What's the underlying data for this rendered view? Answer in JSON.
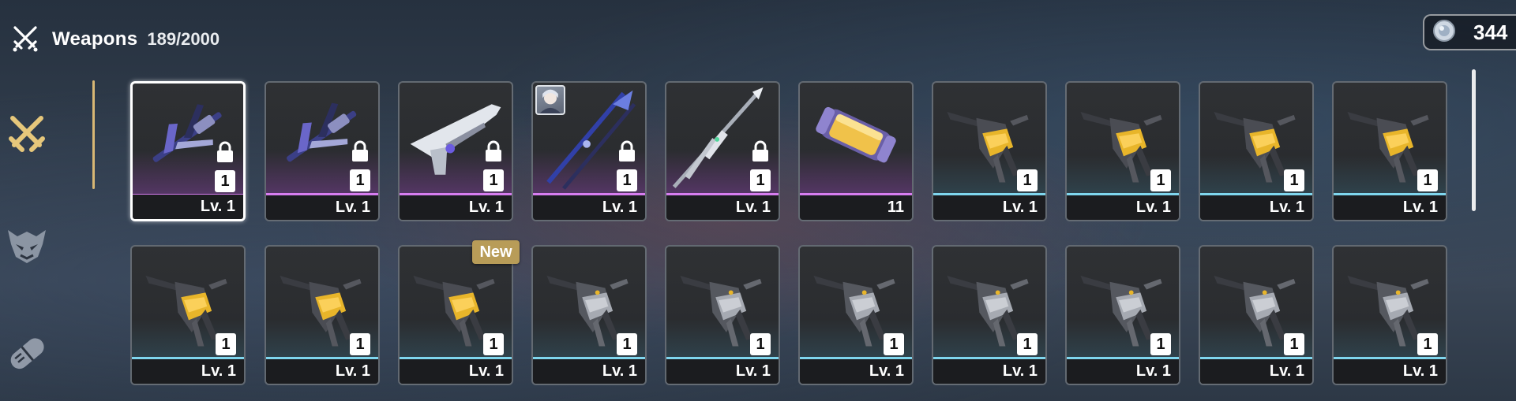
{
  "header": {
    "title": "Weapons",
    "count": "189/2000",
    "icon": "crossed-swords-icon"
  },
  "currency": {
    "icon": "coin-icon",
    "value": "344"
  },
  "nav": {
    "items": [
      {
        "name": "weapons",
        "icon": "crossed-swords-icon",
        "active": true
      },
      {
        "name": "matrices",
        "icon": "demon-mask-icon",
        "active": false
      },
      {
        "name": "relics",
        "icon": "capsule-icon",
        "active": false
      }
    ]
  },
  "colors": {
    "accent": "#d8b774",
    "rarity_purple": "#d77df0",
    "rarity_blue": "#7fd6ee",
    "new_badge": "#b89c58"
  },
  "new_badge": "New",
  "items": [
    {
      "art": "violet-polearm",
      "rarity": "purple",
      "qty": "1",
      "level": "Lv. 1",
      "locked": true,
      "selected": true
    },
    {
      "art": "violet-polearm",
      "rarity": "purple",
      "qty": "1",
      "level": "Lv. 1",
      "locked": true
    },
    {
      "art": "silver-gun",
      "rarity": "purple",
      "qty": "1",
      "level": "Lv. 1",
      "locked": true
    },
    {
      "art": "dual-staff",
      "rarity": "purple",
      "qty": "1",
      "level": "Lv. 1",
      "locked": true,
      "avatar": true
    },
    {
      "art": "spear",
      "rarity": "purple",
      "qty": "1",
      "level": "Lv. 1",
      "locked": true
    },
    {
      "art": "capsule",
      "rarity": "purple",
      "level": "11"
    },
    {
      "art": "gold-claw",
      "rarity": "blue",
      "qty": "1",
      "level": "Lv. 1"
    },
    {
      "art": "gold-claw",
      "rarity": "blue",
      "qty": "1",
      "level": "Lv. 1"
    },
    {
      "art": "gold-claw",
      "rarity": "blue",
      "qty": "1",
      "level": "Lv. 1"
    },
    {
      "art": "gold-claw",
      "rarity": "blue",
      "qty": "1",
      "level": "Lv. 1"
    },
    {
      "art": "gold-claw",
      "rarity": "blue",
      "qty": "1",
      "level": "Lv. 1"
    },
    {
      "art": "gold-claw",
      "rarity": "blue",
      "qty": "1",
      "level": "Lv. 1"
    },
    {
      "art": "gold-claw",
      "rarity": "blue",
      "qty": "1",
      "level": "Lv. 1",
      "new": true
    },
    {
      "art": "grey-claw",
      "rarity": "blue",
      "qty": "1",
      "level": "Lv. 1"
    },
    {
      "art": "grey-claw",
      "rarity": "blue",
      "qty": "1",
      "level": "Lv. 1"
    },
    {
      "art": "grey-claw",
      "rarity": "blue",
      "qty": "1",
      "level": "Lv. 1"
    },
    {
      "art": "grey-claw",
      "rarity": "blue",
      "qty": "1",
      "level": "Lv. 1"
    },
    {
      "art": "grey-claw",
      "rarity": "blue",
      "qty": "1",
      "level": "Lv. 1"
    },
    {
      "art": "grey-claw",
      "rarity": "blue",
      "qty": "1",
      "level": "Lv. 1"
    },
    {
      "art": "grey-claw",
      "rarity": "blue",
      "qty": "1",
      "level": "Lv. 1"
    }
  ]
}
